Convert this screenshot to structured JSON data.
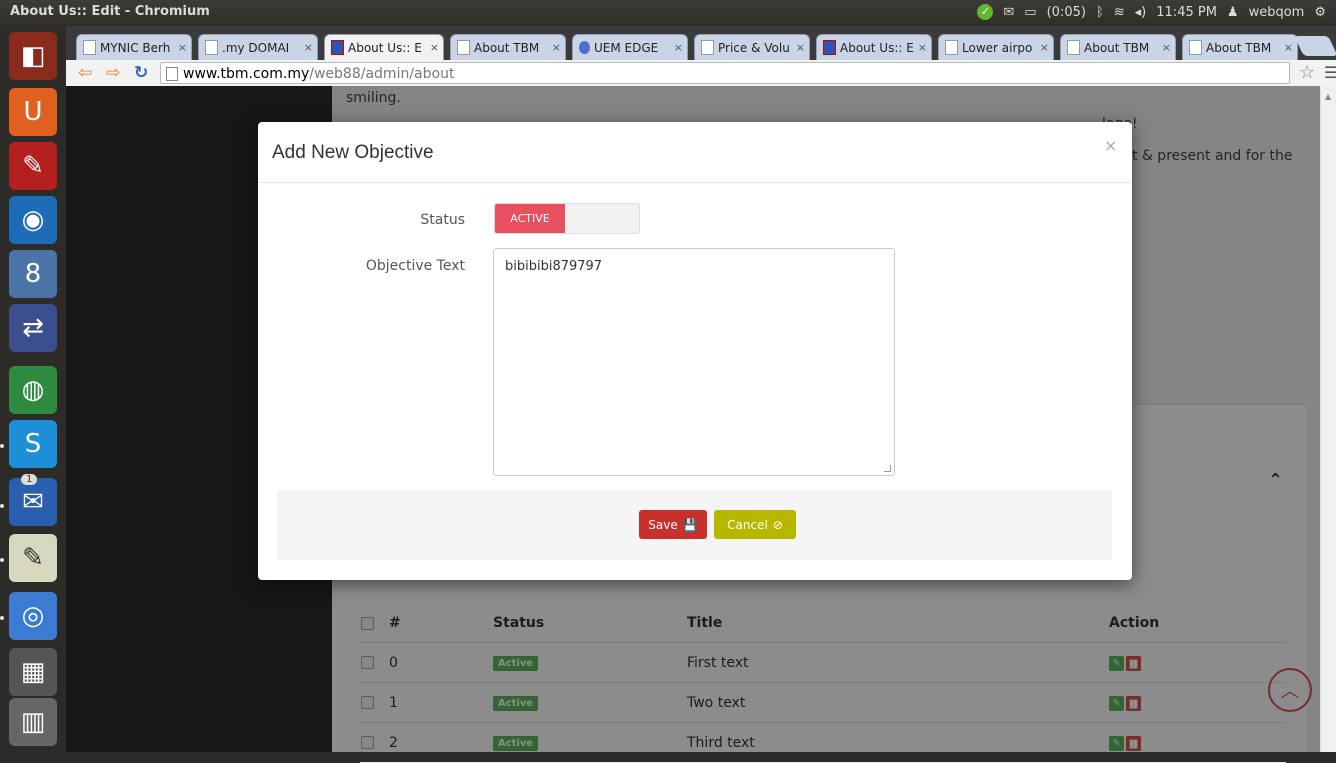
{
  "window": {
    "title": "About Us:: Edit - Chromium"
  },
  "tray": {
    "battery": "(0:05)",
    "clock": "11:45 PM",
    "user": "webqom"
  },
  "tabs": [
    {
      "label": "MYNIC Berh"
    },
    {
      "label": ".my DOMAI"
    },
    {
      "label": "About Us:: E"
    },
    {
      "label": "About TBM"
    },
    {
      "label": "UEM EDGE"
    },
    {
      "label": "Price & Volu"
    },
    {
      "label": "About Us:: E"
    },
    {
      "label": "Lower airpo"
    },
    {
      "label": "About TBM"
    },
    {
      "label": "About TBM"
    }
  ],
  "address": {
    "host": "www.tbm.com.my",
    "path": "/web88/admin/about"
  },
  "launcher": {
    "badge": "1"
  },
  "background": {
    "text_smiling": "smiling.",
    "text_logo": "logo!",
    "text_present": "t & present and for the"
  },
  "modal": {
    "title": "Add New Objective",
    "close": "×",
    "status_label": "Status",
    "status_value": "ACTIVE",
    "objective_label": "Objective Text",
    "objective_value": "bibibibi879797",
    "save_label": "Save",
    "cancel_label": "Cancel"
  },
  "table": {
    "headers": {
      "num": "#",
      "status": "Status",
      "title": "Title",
      "action": "Action"
    },
    "rows": [
      {
        "num": "0",
        "status": "Active",
        "title": "First text"
      },
      {
        "num": "1",
        "status": "Active",
        "title": "Two text"
      },
      {
        "num": "2",
        "status": "Active",
        "title": "Third text"
      }
    ]
  },
  "colors": {
    "save": "#c9302c",
    "cancel": "#b7b700",
    "active_toggle": "#e8505f",
    "badge": "#5cb85c"
  }
}
